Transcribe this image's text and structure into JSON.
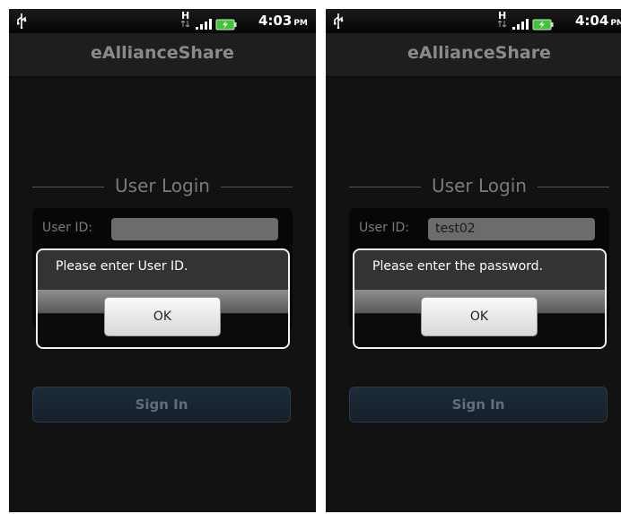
{
  "screens": [
    {
      "status_bar": {
        "time": "4:03",
        "ampm": "PM",
        "network_type": "H"
      },
      "title": "eAllianceShare",
      "section_label": "User Login",
      "userid_label": "User ID:",
      "userid_value": "",
      "dialog": {
        "message": "Please enter User ID.",
        "ok_label": "OK"
      },
      "signin_label": "Sign In"
    },
    {
      "status_bar": {
        "time": "4:04",
        "ampm": "PM",
        "network_type": "H"
      },
      "title": "eAllianceShare",
      "section_label": "User Login",
      "userid_label": "User ID:",
      "userid_value": "test02",
      "dialog": {
        "message": "Please enter the password.",
        "ok_label": "OK"
      },
      "signin_label": "Sign In"
    }
  ],
  "icons": [
    "usb-icon",
    "signal-icon",
    "battery-icon"
  ],
  "colors": {
    "background": "#121212",
    "title_text": "#8a8a8a",
    "signin_text": "#5f6e7a",
    "battery": "#3fc43a"
  }
}
